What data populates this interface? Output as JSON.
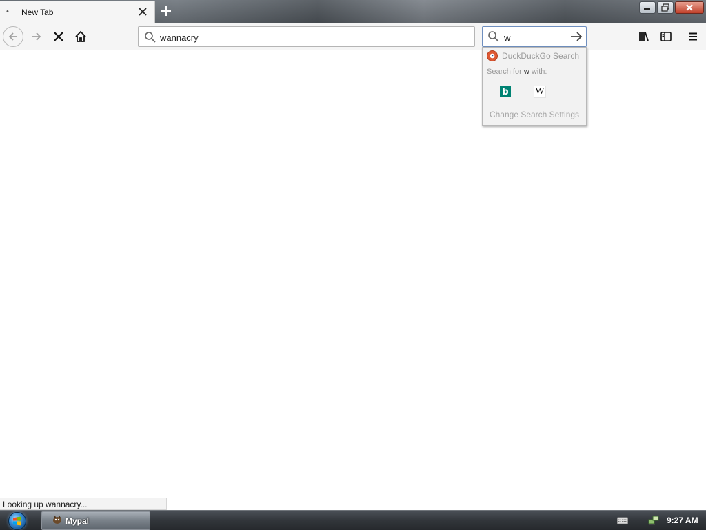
{
  "window": {
    "tab_title": "New Tab",
    "tab_bullet": "•"
  },
  "toolbar": {
    "url_value": "wannacry",
    "search_value": "w"
  },
  "search_popup": {
    "engine_name": "DuckDuckGo Search",
    "search_for_prefix": "Search for ",
    "search_for_term": "w",
    "search_for_suffix": " with:",
    "engines": [
      "bing-icon",
      "wikipedia-icon"
    ],
    "wiki_glyph": "W",
    "bing_glyph": "b",
    "settings_label": "Change Search Settings"
  },
  "status_text": "Looking up wannacry...",
  "taskbar": {
    "app_label": "Mypal",
    "clock": "9:27 AM"
  },
  "colors": {
    "duckduckgo": "#de5833",
    "bing": "#008373",
    "taskbar": "#32363b"
  }
}
